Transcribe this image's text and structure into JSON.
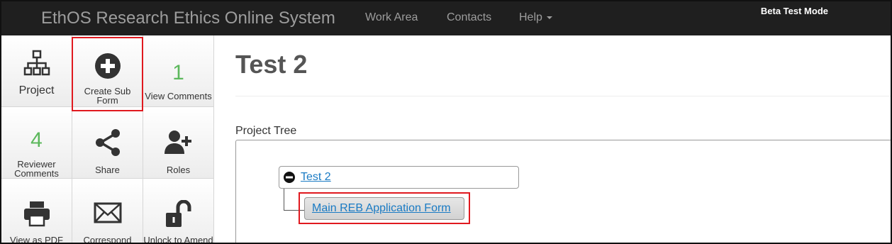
{
  "navbar": {
    "brand": "EthOS Research Ethics Online System",
    "links": [
      "Work Area",
      "Contacts",
      "Help"
    ],
    "mode_badge": "Beta Test Mode"
  },
  "tiles": {
    "project": {
      "label": "Project",
      "icon": "sitemap-icon"
    },
    "create_sub_form": {
      "label_line1": "Create Sub",
      "label_line2": "Form",
      "icon": "plus-circle-icon"
    },
    "view_comments": {
      "count": "1",
      "label": "View Comments"
    },
    "reviewer_comments": {
      "count": "4",
      "label_line1": "Reviewer",
      "label_line2": "Comments"
    },
    "share": {
      "label": "Share",
      "icon": "share-icon"
    },
    "roles": {
      "label": "Roles",
      "icon": "add-user-icon"
    },
    "view_pdf": {
      "label": "View as PDF",
      "icon": "print-icon"
    },
    "correspond": {
      "label": "Correspond",
      "icon": "envelope-icon"
    },
    "unlock": {
      "label": "Unlock to Amend",
      "icon": "unlock-icon"
    }
  },
  "main": {
    "title": "Test 2",
    "tree_label": "Project Tree",
    "tree": {
      "root": "Test 2",
      "child": "Main REB Application Form"
    }
  },
  "colors": {
    "navbar_bg": "#1f1f1f",
    "count_green": "#5cb85c",
    "link_blue": "#1a7bc4",
    "highlight_red": "#e0191f"
  }
}
